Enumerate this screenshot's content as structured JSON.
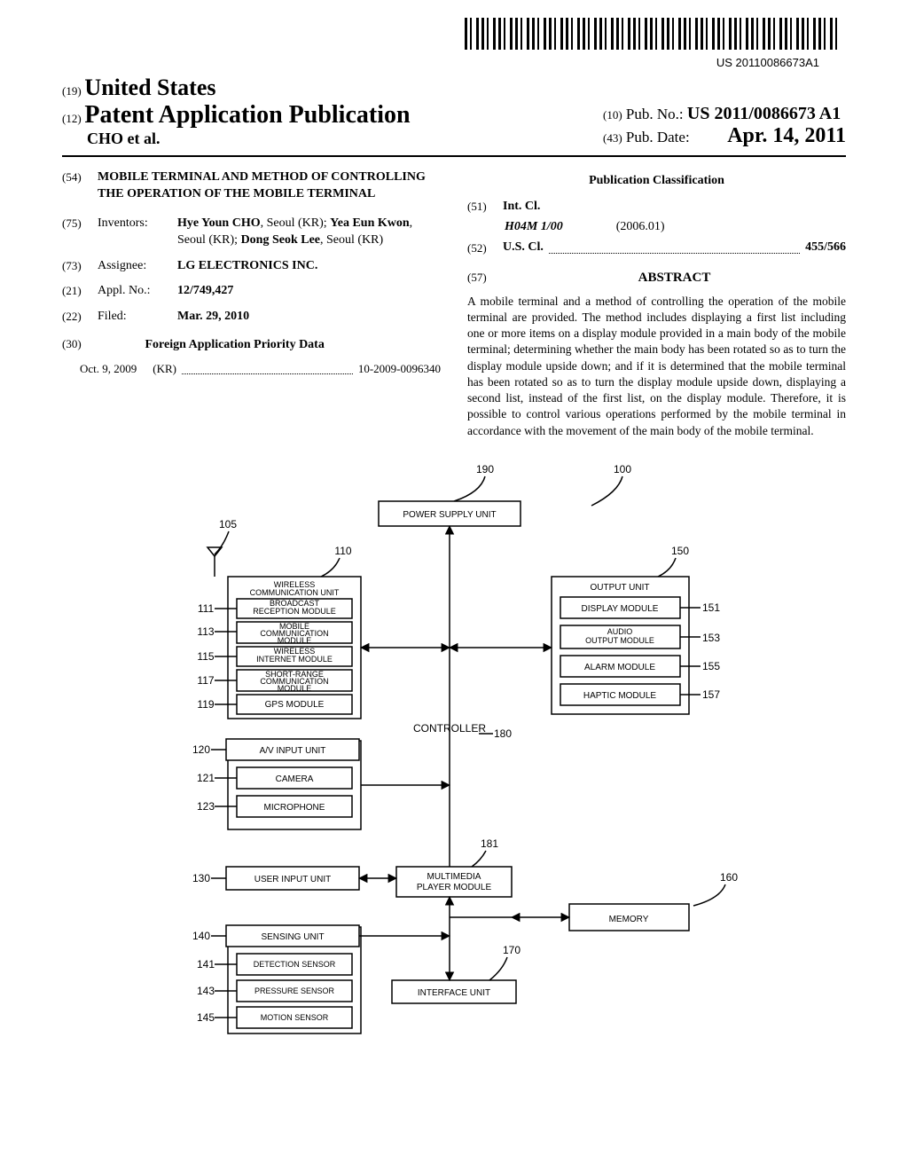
{
  "barcode_id": "US 20110086673A1",
  "header": {
    "country_code": "(19)",
    "country": "United States",
    "pub_code": "(12)",
    "pub_type": "Patent Application Publication",
    "authors": "CHO et al.",
    "pubno_code": "(10)",
    "pubno_label": "Pub. No.:",
    "pubno_value": "US 2011/0086673 A1",
    "pubdate_code": "(43)",
    "pubdate_label": "Pub. Date:",
    "pubdate_value": "Apr. 14, 2011"
  },
  "left": {
    "title_code": "(54)",
    "title": "MOBILE TERMINAL AND METHOD OF CONTROLLING THE OPERATION OF THE MOBILE TERMINAL",
    "inventors_code": "(75)",
    "inventors_label": "Inventors:",
    "inventors": "Hye Youn CHO, Seoul (KR); Yea Eun Kwon, Seoul (KR); Dong Seok Lee, Seoul (KR)",
    "assignee_code": "(73)",
    "assignee_label": "Assignee:",
    "assignee": "LG ELECTRONICS INC.",
    "applno_code": "(21)",
    "applno_label": "Appl. No.:",
    "applno": "12/749,427",
    "filed_code": "(22)",
    "filed_label": "Filed:",
    "filed": "Mar. 29, 2010",
    "foreign_code": "(30)",
    "foreign_label": "Foreign Application Priority Data",
    "foreign_date": "Oct. 9, 2009",
    "foreign_country": "(KR)",
    "foreign_num": "10-2009-0096340"
  },
  "right": {
    "class_hdr": "Publication Classification",
    "intcl_code": "(51)",
    "intcl_label": "Int. Cl.",
    "intcl_class": "H04M 1/00",
    "intcl_date": "(2006.01)",
    "uscl_code": "(52)",
    "uscl_label": "U.S. Cl.",
    "uscl_val": "455/566",
    "abstract_code": "(57)",
    "abstract_hdr": "ABSTRACT",
    "abstract": "A mobile terminal and a method of controlling the operation of the mobile terminal are provided. The method includes displaying a first list including one or more items on a display module provided in a main body of the mobile terminal; determining whether the main body has been rotated so as to turn the display module upside down; and if it is determined that the mobile terminal has been rotated so as to turn the display module upside down, displaying a second list, instead of the first list, on the display module. Therefore, it is possible to control various operations performed by the mobile terminal in accordance with the movement of the main body of the mobile terminal."
  },
  "diagram": {
    "refs": {
      "r190": "190",
      "r100": "100",
      "r105": "105",
      "r110": "110",
      "r150": "150",
      "r111": "111",
      "r113": "113",
      "r115": "115",
      "r117": "117",
      "r119": "119",
      "r120": "120",
      "r121": "121",
      "r123": "123",
      "r130": "130",
      "r140": "140",
      "r141": "141",
      "r143": "143",
      "r145": "145",
      "r151": "151",
      "r153": "153",
      "r155": "155",
      "r157": "157",
      "r160": "160",
      "r170": "170",
      "r180": "180",
      "r181": "181"
    },
    "labels": {
      "power": "POWER SUPPLY UNIT",
      "wcu": "WIRELESS COMMUNICATION UNIT",
      "broadcast": "BROADCAST RECEPTION MODULE",
      "mobile": "MOBILE COMMUNICATION MODULE",
      "wireless_internet": "WIRELESS INTERNET MODULE",
      "short_range": "SHORT-RANGE COMMUNICATION MODULE",
      "gps": "GPS MODULE",
      "av": "A/V INPUT UNIT",
      "camera": "CAMERA",
      "microphone": "MICROPHONE",
      "user_input": "USER INPUT UNIT",
      "sensing": "SENSING UNIT",
      "detection": "DETECTION SENSOR",
      "pressure": "PRESSURE SENSOR",
      "motion": "MOTION SENSOR",
      "controller": "CONTROLLER",
      "multimedia": "MULTIMEDIA PLAYER MODULE",
      "output": "OUTPUT UNIT",
      "display": "DISPLAY MODULE",
      "audio": "AUDIO OUTPUT MODULE",
      "alarm": "ALARM MODULE",
      "haptic": "HAPTIC MODULE",
      "memory": "MEMORY",
      "interface": "INTERFACE UNIT"
    }
  }
}
